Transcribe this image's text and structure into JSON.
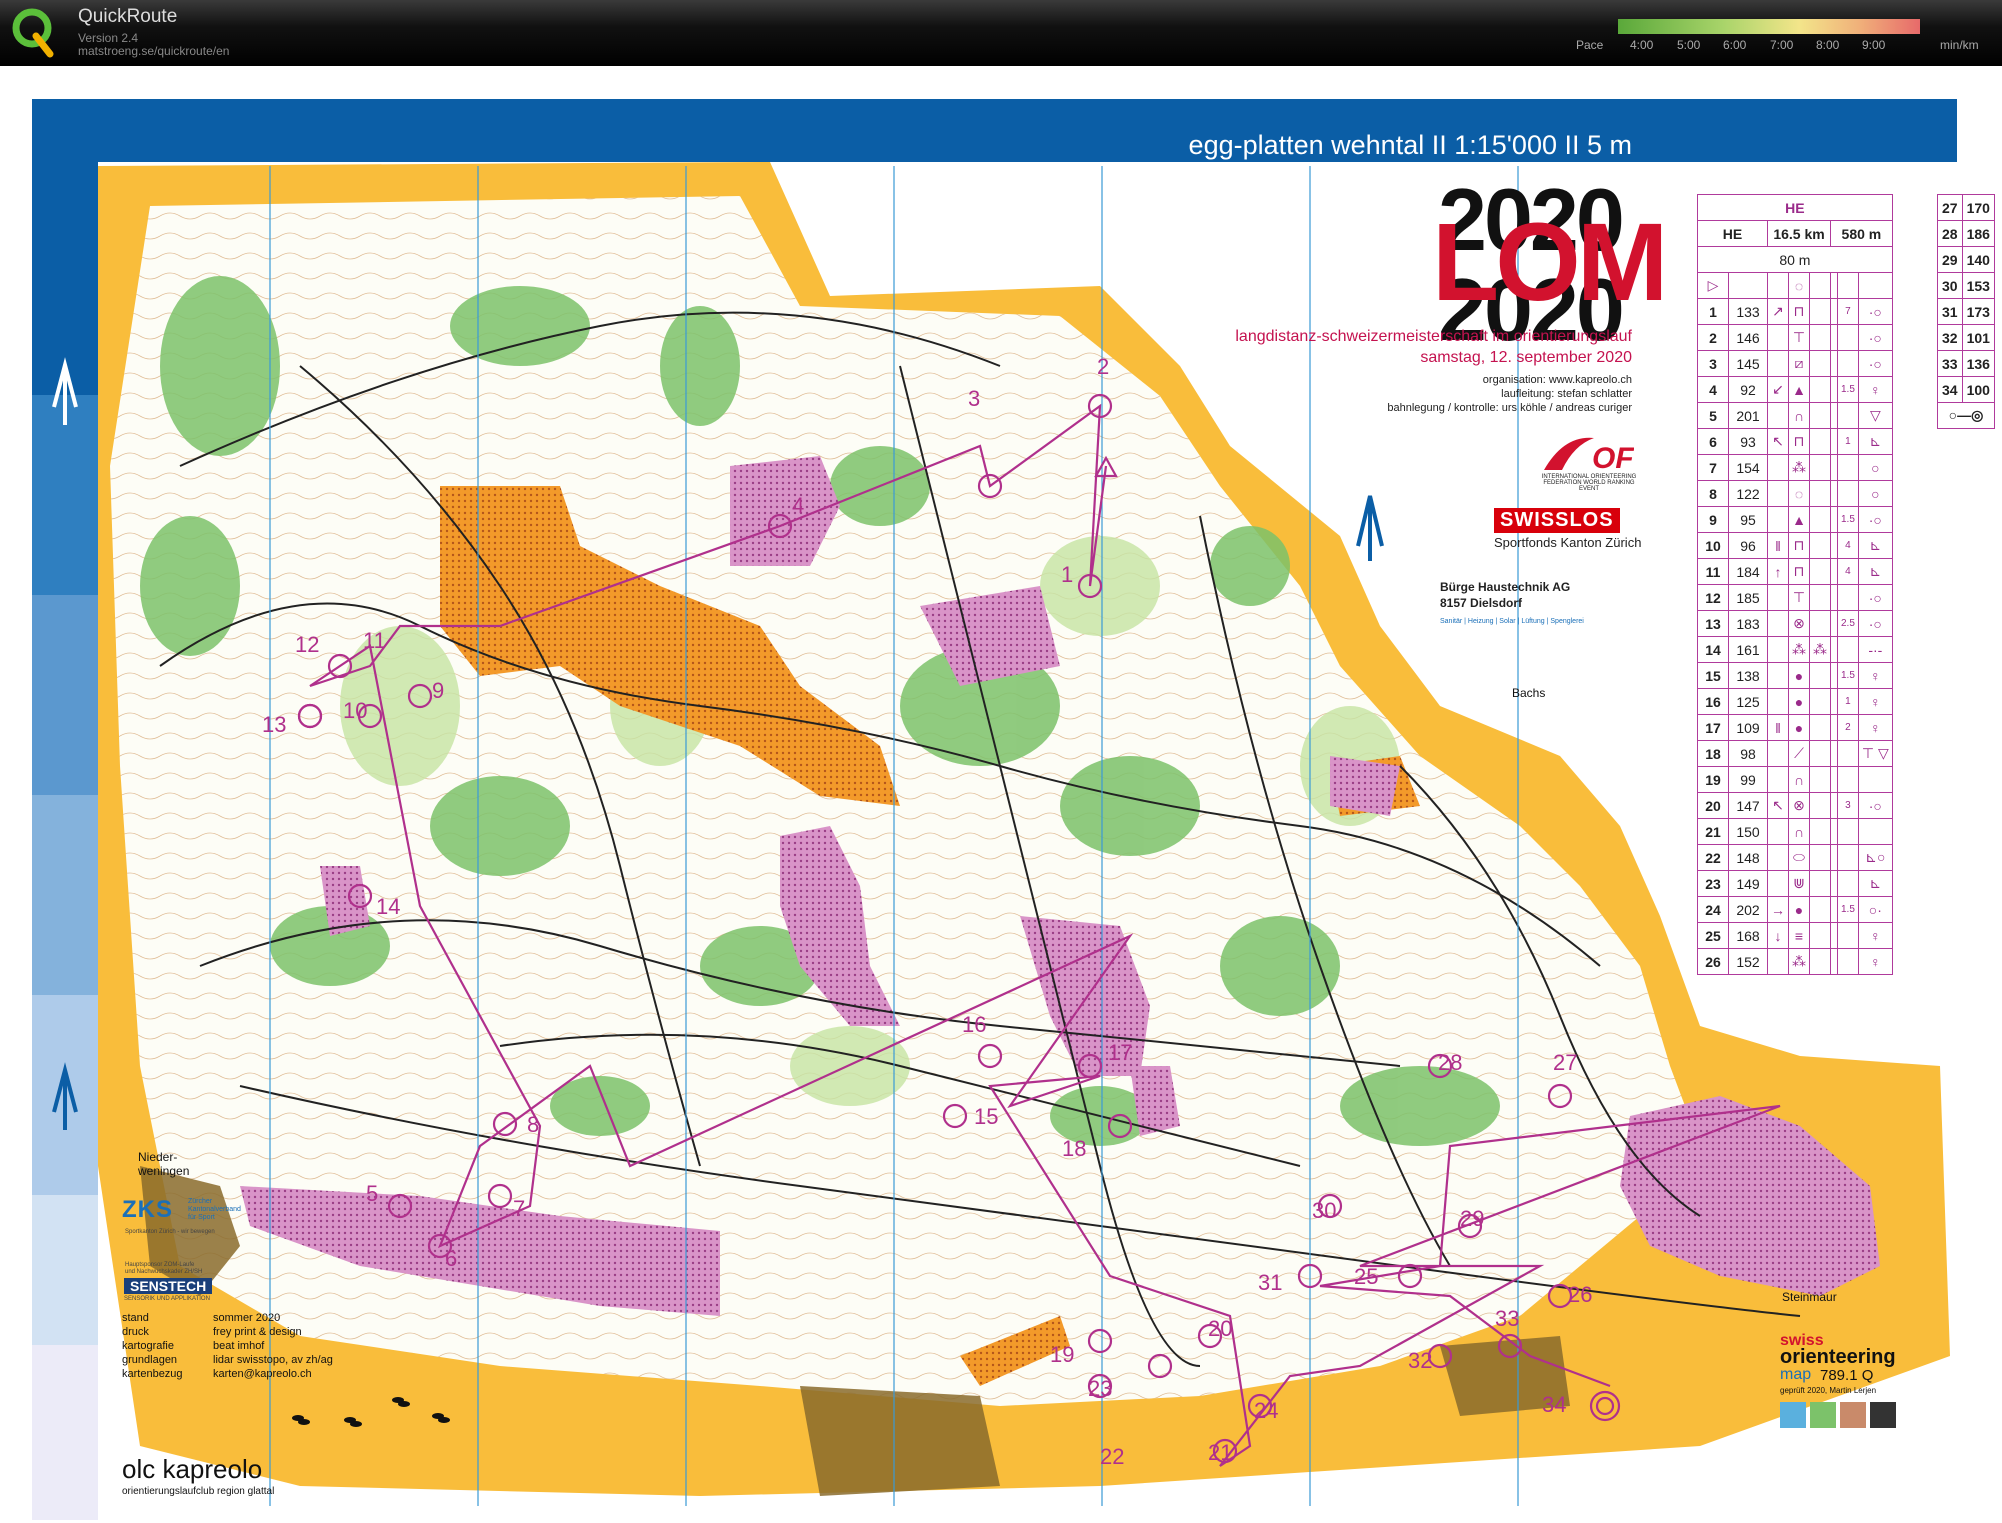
{
  "app": {
    "name": "QuickRoute",
    "version": "Version 2.4",
    "url": "matstroeng.se/quickroute/en",
    "pace_label": "Pace",
    "pace_ticks": [
      "4:00",
      "5:00",
      "6:00",
      "7:00",
      "8:00",
      "9:00"
    ],
    "pace_unit": "min/km"
  },
  "map": {
    "title": "egg-platten wehntal  II  1:15'000  II  5 m",
    "logo_year": "2020",
    "logo_word": "LOM",
    "event_name": "langdistanz-schweizermeisterschaft im orientierungslauf",
    "event_date": "samstag, 12. september 2020",
    "organisation": "organisation: www.kapreolo.ch",
    "laufleitung": "laufleitung: stefan schlatter",
    "bahnlegung": "bahnlegung / kontrolle: urs köhle / andreas curiger",
    "iof_text": "INTERNATIONAL ORIENTEERING FEDERATION WORLD RANKING EVENT",
    "swisslos": "SWISSLOS",
    "swisslos_sub": "Sportfonds Kanton Zürich",
    "sponsor_line1": "Bürge Haustechnik AG",
    "sponsor_line2": "8157 Dielsdorf",
    "sponsor_line3": "Sanitär  |  Heizung  |  Solar  |  Lüftung  |  Spenglerei",
    "places": {
      "bachs": "Bachs",
      "steinmaur": "Steinmaur",
      "nieder1": "Nieder-",
      "nieder2": "weningen"
    }
  },
  "course": {
    "class": "HE",
    "length": "16.5 km",
    "climb": "580 m",
    "finish_dist": "80 m",
    "controls": [
      {
        "n": "1",
        "code": "133",
        "d": "7"
      },
      {
        "n": "2",
        "code": "146",
        "d": ""
      },
      {
        "n": "3",
        "code": "145",
        "d": ""
      },
      {
        "n": "4",
        "code": "92",
        "d": "1.5"
      },
      {
        "n": "5",
        "code": "201",
        "d": ""
      },
      {
        "n": "6",
        "code": "93",
        "d": "1"
      },
      {
        "n": "7",
        "code": "154",
        "d": ""
      },
      {
        "n": "8",
        "code": "122",
        "d": ""
      },
      {
        "n": "9",
        "code": "95",
        "d": "1.5"
      },
      {
        "n": "10",
        "code": "96",
        "d": "4"
      },
      {
        "n": "11",
        "code": "184",
        "d": "4"
      },
      {
        "n": "12",
        "code": "185",
        "d": ""
      },
      {
        "n": "13",
        "code": "183",
        "d": "2.5"
      },
      {
        "n": "14",
        "code": "161",
        "d": ""
      },
      {
        "n": "15",
        "code": "138",
        "d": "1.5"
      },
      {
        "n": "16",
        "code": "125",
        "d": "1"
      },
      {
        "n": "17",
        "code": "109",
        "d": "2"
      },
      {
        "n": "18",
        "code": "98",
        "d": ""
      },
      {
        "n": "19",
        "code": "99",
        "d": ""
      },
      {
        "n": "20",
        "code": "147",
        "d": "3"
      },
      {
        "n": "21",
        "code": "150",
        "d": ""
      },
      {
        "n": "22",
        "code": "148",
        "d": ""
      },
      {
        "n": "23",
        "code": "149",
        "d": ""
      },
      {
        "n": "24",
        "code": "202",
        "d": "1.5"
      },
      {
        "n": "25",
        "code": "168",
        "d": ""
      },
      {
        "n": "26",
        "code": "152",
        "d": ""
      }
    ],
    "controls2": [
      {
        "n": "27",
        "code": "170"
      },
      {
        "n": "28",
        "code": "186"
      },
      {
        "n": "29",
        "code": "140"
      },
      {
        "n": "30",
        "code": "153"
      },
      {
        "n": "31",
        "code": "173"
      },
      {
        "n": "32",
        "code": "101"
      },
      {
        "n": "33",
        "code": "136"
      },
      {
        "n": "34",
        "code": "100"
      }
    ]
  },
  "legend": {
    "zks": "ZKS",
    "zks_sub1": "Zürcher",
    "zks_sub2": "Kantonalverband",
    "zks_sub3": "für Sport",
    "zks_tag": "Sportkanton Zürich - wir bewegen",
    "senstech_note1": "Hauptsponsor ZOM-Laufe",
    "senstech_note2": "und Nachwuchskader ZH/SH",
    "senstech": "SENSTECH",
    "senstech_sub": "SENSORIK UND APPLIKATION",
    "info": [
      {
        "k": "stand",
        "v": "sommer 2020"
      },
      {
        "k": "druck",
        "v": "frey print & design"
      },
      {
        "k": "kartografie",
        "v": "beat imhof"
      },
      {
        "k": "grundlagen",
        "v": "lidar swisstopo, av zh/ag"
      },
      {
        "k": "kartenbezug",
        "v": "karten@kapreolo.ch"
      }
    ],
    "club": "olc kapreolo",
    "club_sub": "orientierungslaufclub region glattal",
    "so_line1": "swiss",
    "so_line2": "orienteering",
    "so_map": "map",
    "so_num": "789.1 Q",
    "so_check": "geprüft 2020, Martin Lerjen"
  },
  "control_labels": [
    "1",
    "2",
    "3",
    "4",
    "5",
    "6",
    "7",
    "8",
    "9",
    "10",
    "11",
    "12",
    "13",
    "14",
    "15",
    "16",
    "17",
    "18",
    "19",
    "20",
    "21",
    "22",
    "23",
    "24",
    "25",
    "26",
    "27",
    "28",
    "29",
    "30",
    "31",
    "32",
    "33",
    "34"
  ]
}
